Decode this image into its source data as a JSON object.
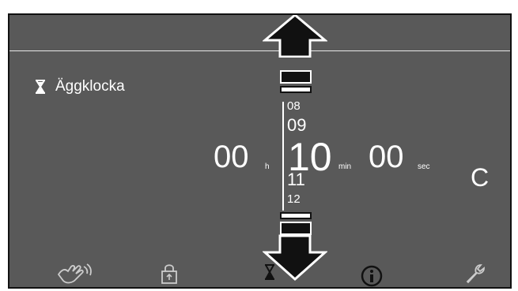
{
  "timer": {
    "label": "Äggklocka",
    "hours": "00",
    "hours_unit": "h",
    "minutes": "10",
    "minutes_unit": "min",
    "seconds": "00",
    "seconds_unit": "sec",
    "clear_label": "C"
  },
  "minute_wheel": {
    "above_2": "08",
    "above_1": "09",
    "below_1": "11",
    "below_2": "12"
  },
  "colors": {
    "background": "#595959",
    "foreground": "#ffffff",
    "outline": "#111111"
  },
  "bottom_bar": {
    "icons": [
      "hand-wave-icon",
      "lock-icon",
      "hourglass-icon",
      "info-icon",
      "wrench-icon"
    ]
  }
}
